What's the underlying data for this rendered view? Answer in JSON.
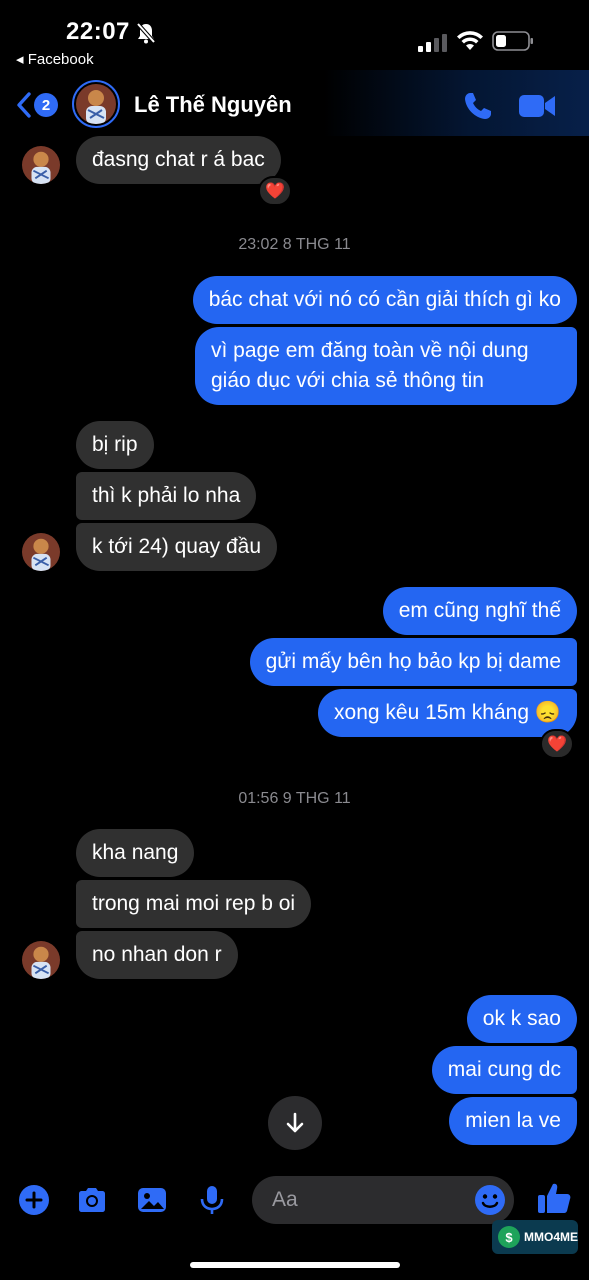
{
  "status": {
    "time": "22:07",
    "back_app": "◂ Facebook"
  },
  "header": {
    "back_count": "2",
    "contact_name": "Lê Thế Nguyên"
  },
  "messages": {
    "m1": "đasng chat r á bac",
    "ts1": "23:02 8 THG 11",
    "m2": "bác chat với nó có cần giải thích gì ko",
    "m3": "vì page em đăng toàn về nội dung giáo dục với chia sẻ thông tin",
    "m4": "bị rip",
    "m5": "thì k phải lo nha",
    "m6": "k tới 24) quay đầu",
    "m7": "em cũng nghĩ thế",
    "m8": "gửi mấy bên họ bảo kp bị dame",
    "m9": "xong kêu 15m kháng 😞",
    "ts2": "01:56 9 THG 11",
    "m10": "kha nang",
    "m11": "trong mai moi rep b oi",
    "m12": "no nhan don r",
    "m13": "ok k sao",
    "m14": "mai cung dc",
    "m15": "mien la ve"
  },
  "reactions": {
    "r1": "❤️",
    "r2": "❤️"
  },
  "composer": {
    "placeholder": "Aa"
  },
  "watermark": {
    "text": "MMO4ME",
    "coin": "$"
  },
  "colors": {
    "accent": "#2466f2",
    "incoming_bubble": "#303030",
    "background": "#000000"
  },
  "icons": [
    "bell-off-icon",
    "signal-icon",
    "wifi-icon",
    "battery-icon",
    "back-chevron-icon",
    "phone-icon",
    "video-icon",
    "arrow-down-icon",
    "plus-icon",
    "camera-icon",
    "image-icon",
    "mic-icon",
    "emoji-icon",
    "like-icon"
  ]
}
